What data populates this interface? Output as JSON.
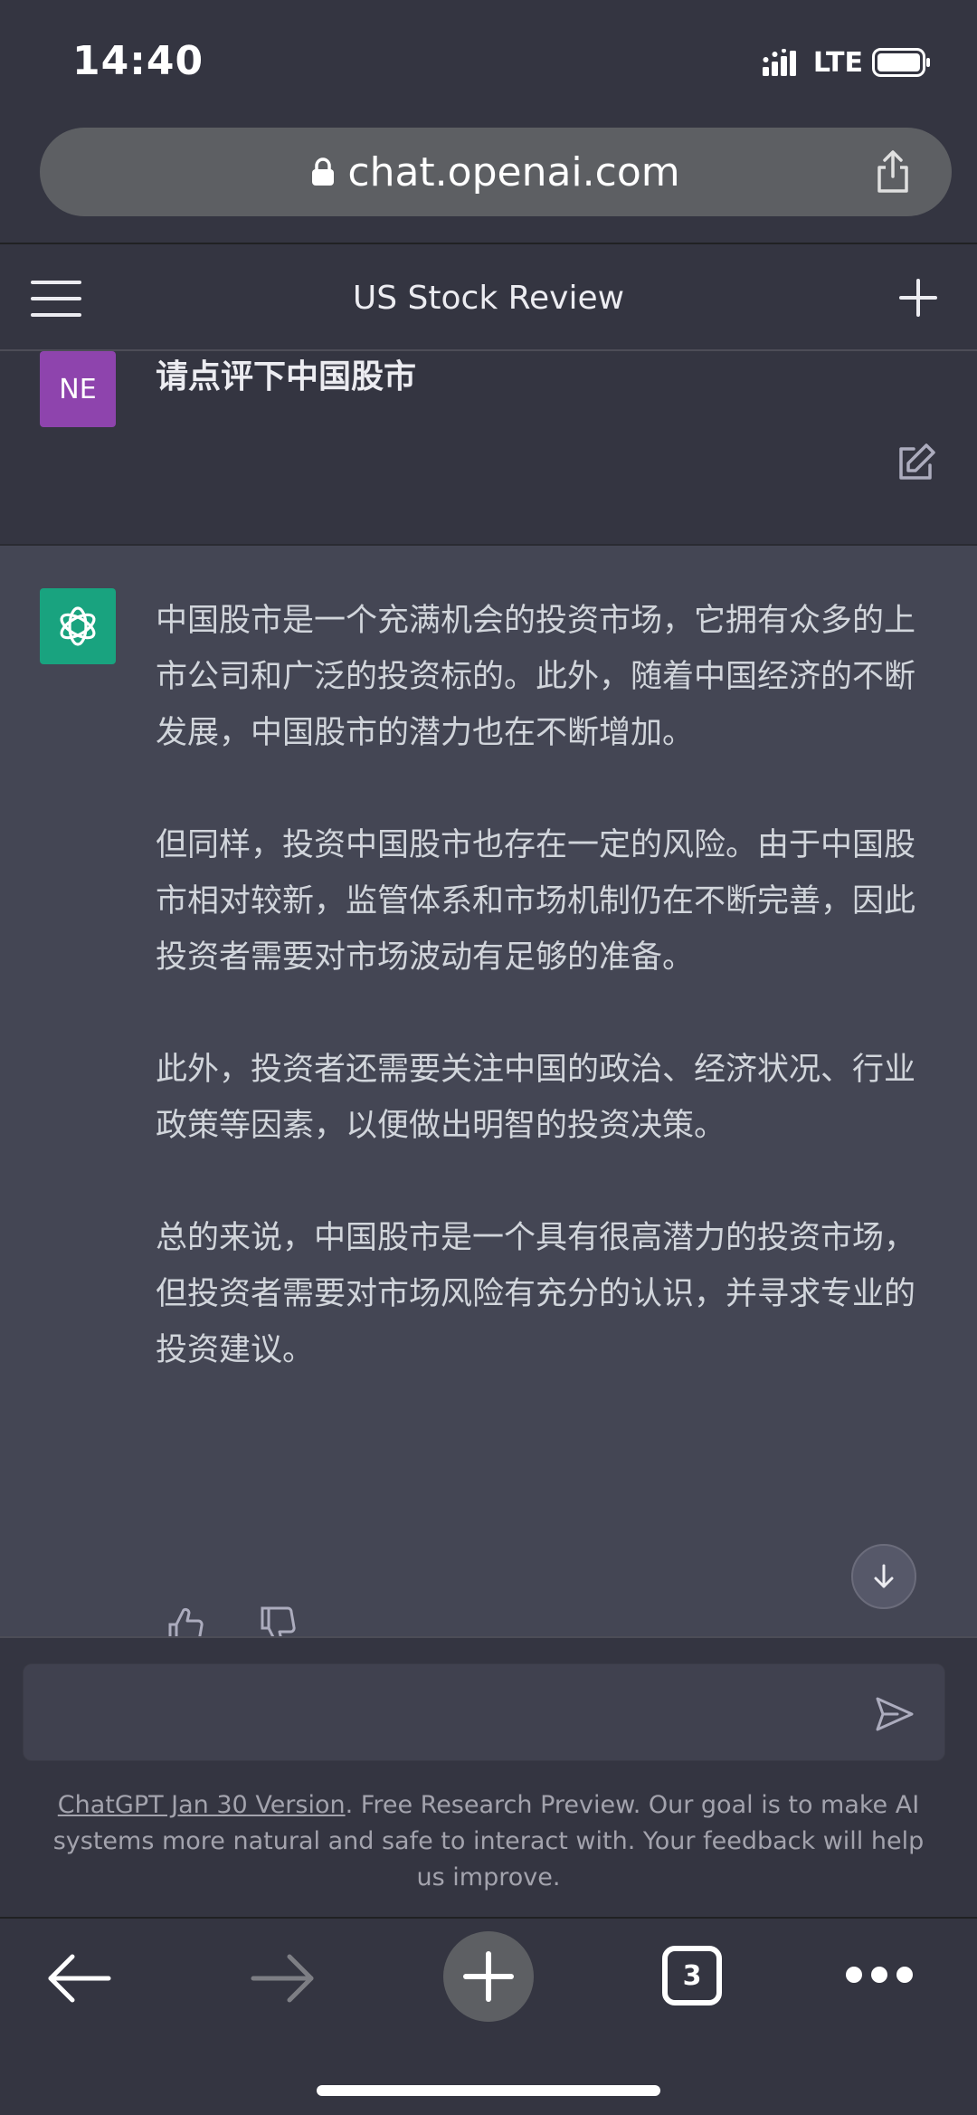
{
  "status_bar": {
    "time": "14:40",
    "network": "LTE",
    "signal_icon": "signal-bars-icon",
    "battery_icon": "battery-icon"
  },
  "browser": {
    "url": "chat.openai.com",
    "lock_icon": "lock-icon",
    "share_icon": "share-icon"
  },
  "header": {
    "title": "US Stock Review",
    "menu_icon": "hamburger-menu-icon",
    "new_chat_icon": "plus-icon"
  },
  "user_message": {
    "avatar_initials": "NE",
    "text": "请点评下中国股市"
  },
  "assistant_message": {
    "paragraphs": [
      "中国股市是一个充满机会的投资市场，它拥有众多的上市公司和广泛的投资标的。此外，随着中国经济的不断发展，中国股市的潜力也在不断增加。",
      "但同样，投资中国股市也存在一定的风险。由于中国股市相对较新，监管体系和市场机制仍在不断完善，因此投资者需要对市场波动有足够的准备。",
      "此外，投资者还需要关注中国的政治、经济状况、行业政策等因素，以便做出明智的投资决策。",
      "总的来说，中国股市是一个具有很高潜力的投资市场，但投资者需要对市场风险有充分的认识，并寻求专业的投资建议。"
    ]
  },
  "input": {
    "placeholder": "",
    "value": ""
  },
  "footer": {
    "link_text": "ChatGPT Jan 30 Version",
    "note": ". Free Research Preview. Our goal is to make AI systems more natural and safe to interact with. Your feedback will help us improve."
  },
  "bottom_bar": {
    "tab_count": "3"
  },
  "colors": {
    "background": "#343541",
    "assistant_bg": "#444654",
    "user_avatar": "#8e44ad",
    "bot_avatar": "#19a37f"
  }
}
